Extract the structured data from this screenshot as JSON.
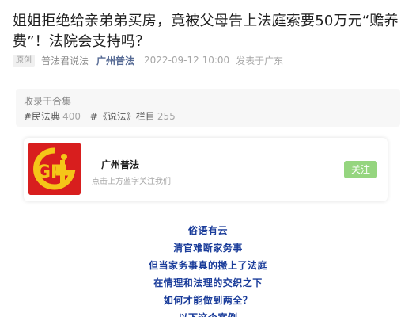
{
  "article": {
    "title": "姐姐拒绝给亲弟弟买房，竟被父母告上法庭索要50万元“赡养费”！法院会支持吗？",
    "badge": "原创",
    "author": "普法君说法",
    "account": "广州普法",
    "date": "2022-09-12 10:00",
    "location": "发表于广东"
  },
  "collection": {
    "label": "收录于合集",
    "tags": [
      {
        "name": "#民法典",
        "count": "400"
      },
      {
        "name": "#《说法》栏目",
        "count": "255"
      }
    ]
  },
  "account_card": {
    "name": "广州普法",
    "hint": "点击上方蓝字关注我们",
    "follow_label": "关注",
    "logo_text": "GP"
  },
  "body": {
    "lines": [
      "俗语有云",
      "清官难断家务事",
      "但当家务事真的搬上了法庭",
      "在情理和法理的交织之下",
      "如何才能做到两全？",
      "以下这个案例"
    ]
  },
  "colors": {
    "link": "#576b95",
    "body_text": "#1a3c9a",
    "follow_button": "#95d57f",
    "logo_bg": "#d81e1e",
    "logo_accent": "#f5c518"
  }
}
